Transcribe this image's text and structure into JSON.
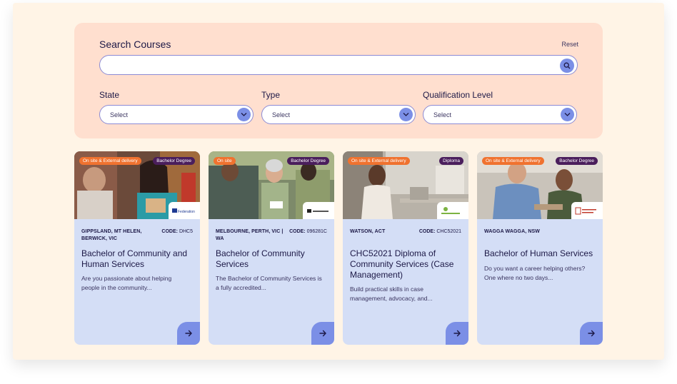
{
  "search": {
    "title": "Search Courses",
    "reset_label": "Reset",
    "query_value": "",
    "placeholder": ""
  },
  "filters": [
    {
      "label": "State",
      "value": "Select"
    },
    {
      "label": "Type",
      "value": "Select"
    },
    {
      "label": "Qualification Level",
      "value": "Select"
    }
  ],
  "colors": {
    "accent": "#7b8fe6",
    "panel": "#ffdfcf",
    "card": "#d4def6",
    "delivery_badge": "#f0722f",
    "level_badge": "#4a1e5c",
    "text": "#1c1846"
  },
  "cards": [
    {
      "delivery": "On site & External delivery",
      "level": "Bachelor Degree",
      "location": "GIPPSLAND, MT HELEN, BERWICK, VIC",
      "code_label": "CODE:",
      "code": "DHC5",
      "title": "Bachelor of Community and Human Services",
      "description": "Are you passionate about helping people in the community...",
      "logo": "federation-university-logo",
      "logo_text": "Federation"
    },
    {
      "delivery": "On site",
      "level": "Bachelor Degree",
      "location": "MELBOURNE, PERTH, VIC | WA",
      "code_label": "CODE:",
      "code": "096281C",
      "title": "Bachelor of Community Services",
      "description": "The Bachelor of Community Services is a fully accredited...",
      "logo": "provider-logo",
      "logo_text": ""
    },
    {
      "delivery": "On site & External delivery",
      "level": "Diploma",
      "location": "WATSON, ACT",
      "code_label": "CODE:",
      "code": "CHC52021",
      "title": "CHC52021 Diploma of Community Services (Case Management)",
      "description": "Build practical skills in case management, advocacy, and...",
      "logo": "wellbeing-college-logo",
      "logo_text": ""
    },
    {
      "delivery": "On site & External delivery",
      "level": "Bachelor Degree",
      "location": "WAGGA WAGGA, NSW",
      "code_label": "",
      "code": "",
      "title": "Bachelor of Human Services",
      "description": "Do you want a career helping others? One where no two days...",
      "logo": "charles-sturt-university-logo",
      "logo_text": ""
    }
  ]
}
